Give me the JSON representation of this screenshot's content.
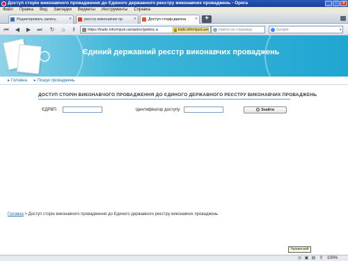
{
  "window": {
    "title": "Доступ сторін виконавчого провадження до Єдиного державного реєстру виконавчих проваджень - Opera"
  },
  "menu": [
    "Файл",
    "Правка",
    "Вид",
    "Закладки",
    "Виджеты",
    "Инструменты",
    "Справка"
  ],
  "tabs": [
    {
      "label": "Редактировать запись",
      "favicon_color": "#3a6fb8",
      "active": false
    },
    {
      "label": "реєстр виконавчих пр",
      "favicon_color": "#d33c2a",
      "active": false
    },
    {
      "label": "Доступ сторін викона",
      "favicon_color": "#e0552d",
      "active": true
    }
  ],
  "toolbar": {
    "address": "https://trade.informjust.ua/vpdoc/getdoc.a",
    "secure_label": "trade.informjust.ua",
    "page_search_placeholder": "Найти на странице",
    "web_search_placeholder": "Google"
  },
  "banner": {
    "title": "Єдиний державний реєстр виконавчих проваджень"
  },
  "breadcrumb_top": [
    "Головна",
    "Пошук проваджень"
  ],
  "form": {
    "title": "ДОСТУП СТОРІН ВИКОНАВЧОГО ПРОВАДЖЕННЯ ДО ЄДИНОГО ДЕРЖАВНОГО РЕЄСТРУ ВИКОНАВЧИХ ПРОВАДЖЕНЬ",
    "edrvp_label": "ЄДРВП:",
    "edrvp_value": "",
    "access_label": "Ідентифікатор доступу:",
    "access_value": "",
    "submit_label": "Знайти"
  },
  "footer": {
    "home_link": "Головна",
    "separator": " > ",
    "current": "Доступ сторін виконавчого провадження до Єдиного державного реєстру виконавчих проваджень"
  },
  "status": {
    "language_tooltip": "Украинский",
    "zoom": "100%"
  },
  "colors": {
    "banner": "#1fa6d2",
    "link": "#1b6fb3",
    "accent_line": "#5a9fd4"
  }
}
